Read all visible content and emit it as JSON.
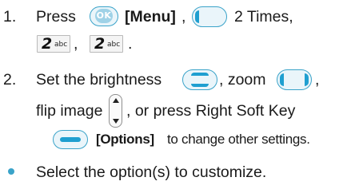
{
  "steps": [
    {
      "number": "1.",
      "press": "Press",
      "ok_key": "OK",
      "menu_label": "[Menu]",
      "sep1": ",",
      "times": "2 Times,",
      "key_digit": "2",
      "key_letters": "abc",
      "sep2": ",",
      "end": "."
    },
    {
      "number": "2.",
      "set_brightness": "Set the brightness",
      "zoom": ", zoom",
      "comma": ",",
      "flip_image": "flip image",
      "or_press": ", or press Right Soft Key",
      "options_label": "[Options]",
      "change_settings": "to change other settings."
    }
  ],
  "bullet": {
    "text": "Select the option(s) to customize."
  },
  "colors": {
    "accent": "#3aa3c9",
    "accent_dark": "#1f9fd0",
    "text": "#1a1a1a"
  },
  "icons": [
    "ok-key-icon",
    "nav-left-right-icon",
    "key-2-abc-icon",
    "nav-up-down-icon",
    "flip-image-icon",
    "right-soft-key-icon"
  ]
}
